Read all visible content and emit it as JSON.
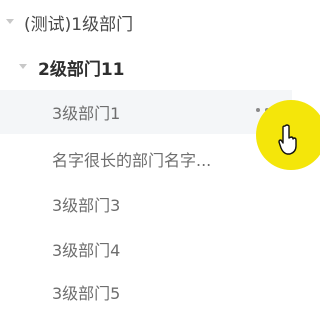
{
  "tree": {
    "root": {
      "label": "(测试)1级部门"
    },
    "level2": {
      "label": "2级部门11"
    },
    "children": [
      {
        "label": "3级部门1"
      },
      {
        "label": "名字很长的部门名字..."
      },
      {
        "label": "3级部门3"
      },
      {
        "label": "3级部门4"
      },
      {
        "label": "3级部门5"
      }
    ],
    "more_icon": "more-horizontal-icon"
  },
  "colors": {
    "hover_bg": "#f4f6f8",
    "highlight": "#f4e60a"
  }
}
